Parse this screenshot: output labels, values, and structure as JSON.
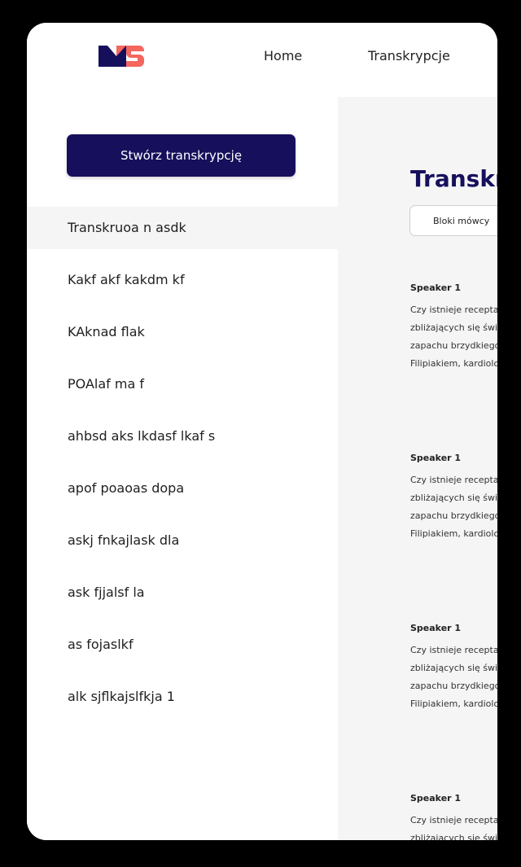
{
  "brand": {
    "logo_colors": {
      "dark": "#16105c",
      "accent": "#f4665e"
    }
  },
  "nav": {
    "home": "Home",
    "transcriptions": "Transkrypcje"
  },
  "sidebar": {
    "create_button": "Stwórz transkrypcję",
    "items": [
      {
        "label": "Transkruoa n asdk",
        "active": true
      },
      {
        "label": "Kakf akf kakdm kf"
      },
      {
        "label": "KAknad flak"
      },
      {
        "label": "POAlaf ma f"
      },
      {
        "label": "ahbsd aks lkdasf lkaf s"
      },
      {
        "label": "apof poaoas dopa"
      },
      {
        "label": "askj fnkajlask dla"
      },
      {
        "label": "ask fjjalsf la"
      },
      {
        "label": "as fojaslkf"
      },
      {
        "label": "alk sjflkajslfkja 1"
      }
    ]
  },
  "main": {
    "title": "Transkr",
    "tab": "Bloki mówcy",
    "blocks": [
      {
        "speaker": "Speaker 1",
        "lines": [
          "Czy istnieje recepta",
          "zbliżających się świ",
          "zapachu brzydkiego",
          "Filipiakiem, kardiolo"
        ]
      },
      {
        "speaker": "Speaker 1",
        "lines": [
          "Czy istnieje recepta",
          "zbliżających się świ",
          "zapachu brzydkiego",
          "Filipiakiem, kardiolo"
        ]
      },
      {
        "speaker": "Speaker 1",
        "lines": [
          "Czy istnieje recepta",
          "zbliżających się świ",
          "zapachu brzydkiego",
          "Filipiakiem, kardiolo"
        ]
      },
      {
        "speaker": "Speaker 1",
        "lines": [
          "Czy istnieje recepta",
          "zbliżających się świ"
        ]
      }
    ]
  },
  "colors": {
    "primary": "#16105c",
    "sidebar_active": "#f5f5f5",
    "main_bg": "#f5f5f6"
  }
}
